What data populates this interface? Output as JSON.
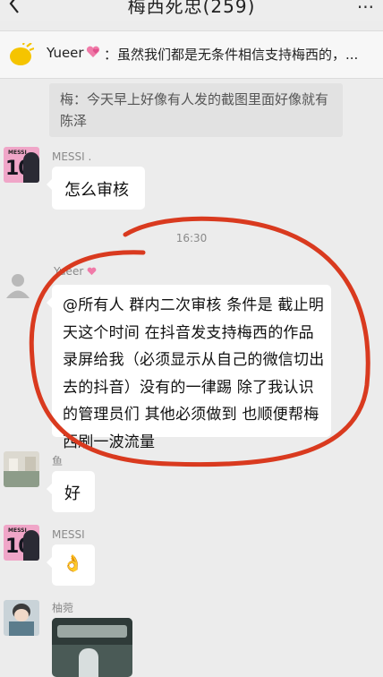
{
  "header": {
    "title": "梅西死忠(259)",
    "back_icon": "back-arrow-icon",
    "more_icon": "more-icon"
  },
  "notice": {
    "icon": "megaphone-icon",
    "name": "Yueer",
    "heart_icon": "heart-icon",
    "text": "：虽然我们都是无条件相信支持梅西的，..."
  },
  "quote": {
    "text": "梅：今天早上好像有人发的截图里面好像就有陈泽"
  },
  "messages": [
    {
      "sender": "MESSI .",
      "text": "怎么审核",
      "avatar_text": "10",
      "avatar_label": "MESSI"
    },
    {
      "sender": "鱼",
      "text": "好"
    },
    {
      "sender": "MESSI",
      "text": "👌",
      "avatar_text": "10",
      "avatar_label": "MESSI"
    },
    {
      "sender": "柚菀"
    }
  ],
  "timestamp": "16:30",
  "announcement": {
    "sender": "Yueer",
    "text": "@所有人 群内二次审核 条件是 截止明天这个时间 在抖音发支持梅西的作品 录屏给我（必须显示从自己的微信切出去的抖音）没有的一律踢 除了我认识的管理员们 其他必须做到 也顺便帮梅西刷一波流量"
  },
  "colors": {
    "background": "#ececec",
    "bubble": "#ffffff",
    "annotation": "#d93a1f",
    "avatar_pink": "#f0a6c8"
  }
}
